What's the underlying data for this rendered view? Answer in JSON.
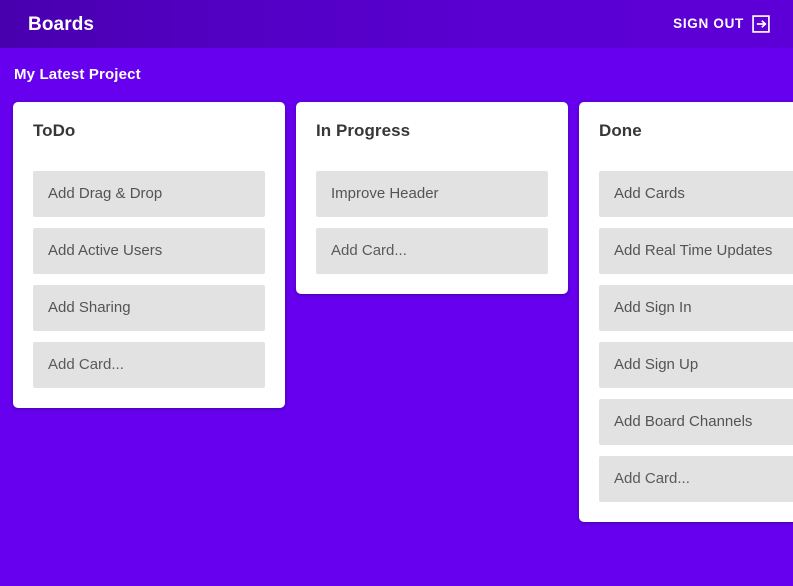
{
  "header": {
    "title": "Boards",
    "signout_label": "SIGN OUT",
    "signout_icon": "logout-icon"
  },
  "board": {
    "title": "My Latest Project",
    "background_color": "#6600EE",
    "appbar_color": "#5200C2",
    "card_color": "#E2E2E2",
    "column_color": "#FFFFFF",
    "columns": [
      {
        "title": "ToDo",
        "cards": [
          {
            "text": "Add Drag & Drop",
            "placeholder": false
          },
          {
            "text": "Add Active Users",
            "placeholder": false
          },
          {
            "text": "Add Sharing",
            "placeholder": false
          },
          {
            "text": "Add Card...",
            "placeholder": true
          }
        ]
      },
      {
        "title": "In Progress",
        "cards": [
          {
            "text": "Improve Header",
            "placeholder": false
          },
          {
            "text": "Add Card...",
            "placeholder": true
          }
        ]
      },
      {
        "title": "Done",
        "cards": [
          {
            "text": "Add Cards",
            "placeholder": false
          },
          {
            "text": "Add Real Time Updates",
            "placeholder": false
          },
          {
            "text": "Add Sign In",
            "placeholder": false
          },
          {
            "text": "Add Sign Up",
            "placeholder": false
          },
          {
            "text": "Add Board Channels",
            "placeholder": false
          },
          {
            "text": "Add Card...",
            "placeholder": true
          }
        ]
      }
    ]
  }
}
